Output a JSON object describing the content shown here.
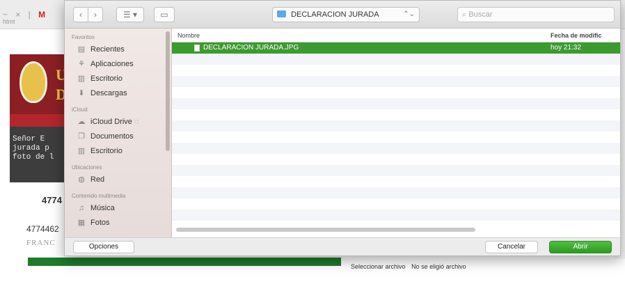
{
  "background_page": {
    "address_text": "htmt",
    "banner_letters": "U\nD",
    "message_text": "Señor E\njurada p\nfoto de l",
    "number_primary": "4774",
    "number_secondary": "4774462",
    "name_fragment": "FRANC",
    "file_select_button": "Seleccionar archivo",
    "file_status": "No se eligió archivo",
    "accent_color": "#8b1f24",
    "progress_color": "#1f7a2a"
  },
  "dialog": {
    "path_label": "DECLARACION JURADA",
    "search_placeholder": "Buscar",
    "sidebar": {
      "favorites_title": "Favoritos",
      "favorites": [
        {
          "label": "Recientes",
          "icon": "recents-icon"
        },
        {
          "label": "Aplicaciones",
          "icon": "applications-icon"
        },
        {
          "label": "Escritorio",
          "icon": "desktop-icon"
        },
        {
          "label": "Descargas",
          "icon": "downloads-icon"
        }
      ],
      "icloud_title": "iCloud",
      "icloud": [
        {
          "label": "iCloud Drive",
          "icon": "icloud-icon"
        },
        {
          "label": "Documentos",
          "icon": "documents-icon"
        },
        {
          "label": "Escritorio",
          "icon": "desktop-icon"
        }
      ],
      "locations_title": "Ubicaciones",
      "locations": [
        {
          "label": "Red",
          "icon": "network-icon"
        }
      ],
      "media_title": "Contenido multimedia",
      "media": [
        {
          "label": "Música",
          "icon": "music-icon"
        },
        {
          "label": "Fotos",
          "icon": "photos-icon"
        }
      ]
    },
    "columns": {
      "name": "Nombre",
      "date": "Fecha de modific"
    },
    "files": [
      {
        "name": "DECLARACION JURADA.JPG",
        "date": "hoy 21:32",
        "selected": true
      }
    ],
    "buttons": {
      "options": "Opciones",
      "cancel": "Cancelar",
      "open": "Abrir"
    },
    "selection_color": "#3b9b2f"
  }
}
